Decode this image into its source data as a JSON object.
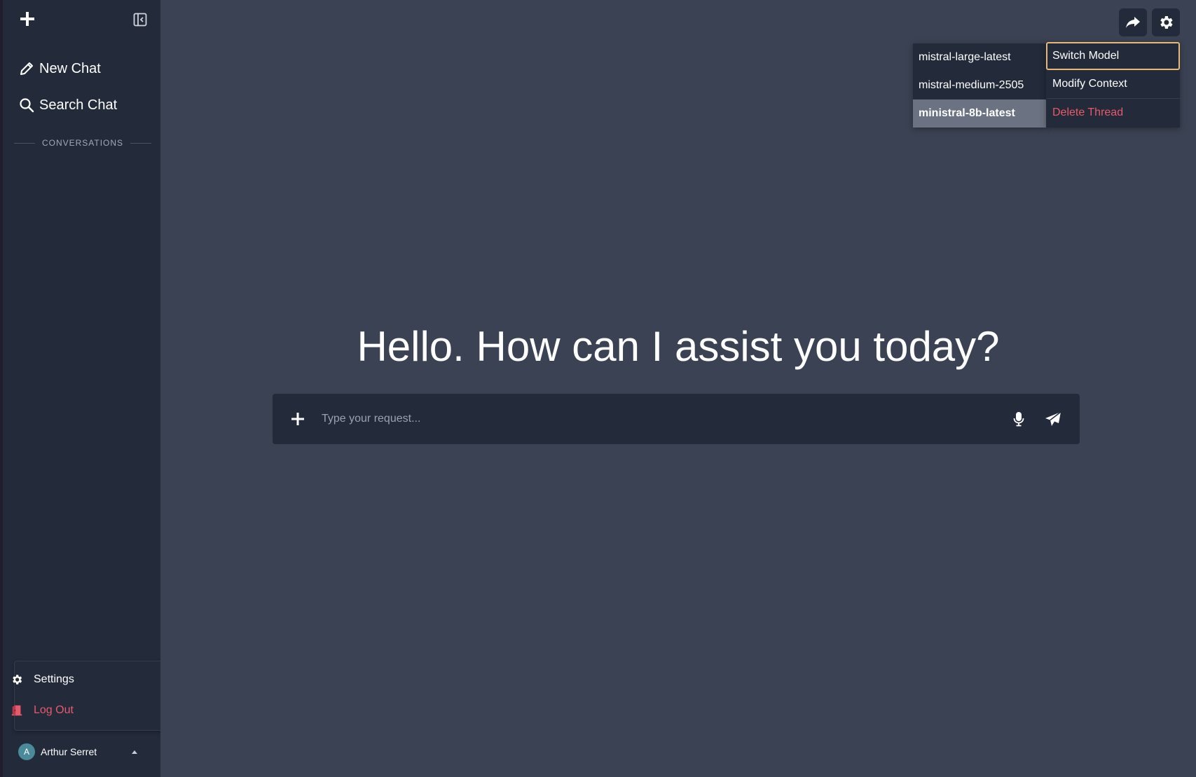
{
  "sidebar": {
    "new_chat_label": "New Chat",
    "search_chat_label": "Search Chat",
    "conversations_heading": "CONVERSATIONS"
  },
  "user_menu": {
    "settings_label": "Settings",
    "logout_label": "Log Out"
  },
  "user": {
    "initial": "A",
    "name": "Arthur Serret"
  },
  "model_menu": {
    "items": [
      "mistral-large-latest",
      "mistral-medium-2505",
      "ministral-8b-latest"
    ],
    "selected": "ministral-8b-latest"
  },
  "context_menu": {
    "switch_model": "Switch Model",
    "modify_context": "Modify Context",
    "delete_thread": "Delete Thread"
  },
  "main": {
    "greeting": "Hello. How can I assist you today?"
  },
  "composer": {
    "placeholder": "Type your request..."
  },
  "colors": {
    "sidebar_bg": "#232a3a",
    "main_bg": "#3b4253",
    "danger": "#e85a6a",
    "focus_ring": "#e8b878",
    "selected_item_bg": "#6b7282"
  }
}
